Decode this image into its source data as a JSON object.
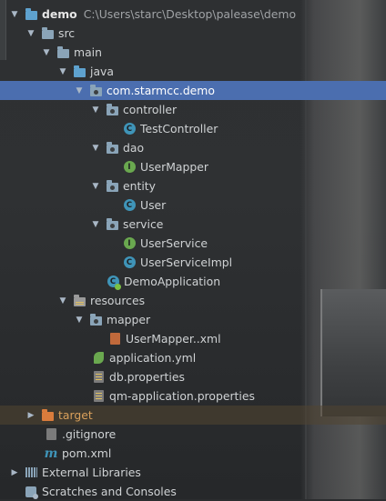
{
  "tree": [
    {
      "label": "demo",
      "path": "C:\\Users\\starc\\Desktop\\palease\\demo",
      "arrow": "▼",
      "icon": "module-folder-icon"
    },
    {
      "label": "src",
      "arrow": "▼",
      "icon": "folder-icon"
    },
    {
      "label": "main",
      "arrow": "▼",
      "icon": "folder-icon"
    },
    {
      "label": "java",
      "arrow": "▼",
      "icon": "source-folder-icon"
    },
    {
      "label": "com.starmcc.demo",
      "arrow": "▼",
      "icon": "package-icon"
    },
    {
      "label": "controller",
      "arrow": "▼",
      "icon": "package-icon"
    },
    {
      "label": "TestController",
      "icon": "class-icon",
      "badge": "C"
    },
    {
      "label": "dao",
      "arrow": "▼",
      "icon": "package-icon"
    },
    {
      "label": "UserMapper",
      "icon": "interface-icon",
      "badge": "I"
    },
    {
      "label": "entity",
      "arrow": "▼",
      "icon": "package-icon"
    },
    {
      "label": "User",
      "icon": "class-icon",
      "badge": "C"
    },
    {
      "label": "service",
      "arrow": "▼",
      "icon": "package-icon"
    },
    {
      "label": "UserService",
      "icon": "interface-icon",
      "badge": "I"
    },
    {
      "label": "UserServiceImpl",
      "icon": "class-icon",
      "badge": "C"
    },
    {
      "label": "DemoApplication",
      "icon": "spring-boot-app-icon",
      "badge": "C"
    },
    {
      "label": "resources",
      "arrow": "▼",
      "icon": "resources-folder-icon"
    },
    {
      "label": "mapper",
      "arrow": "▼",
      "icon": "package-icon"
    },
    {
      "label": "UserMapper..xml",
      "icon": "xml-file-icon"
    },
    {
      "label": "application.yml",
      "icon": "yml-file-icon"
    },
    {
      "label": "db.properties",
      "icon": "properties-file-icon"
    },
    {
      "label": "qm-application.properties",
      "icon": "properties-file-icon"
    },
    {
      "label": "target",
      "arrow": "▶",
      "icon": "excluded-folder-icon"
    },
    {
      "label": ".gitignore",
      "icon": "gitignore-file-icon"
    },
    {
      "label": "pom.xml",
      "icon": "maven-icon"
    },
    {
      "label": "External Libraries",
      "arrow": "▶",
      "icon": "libraries-icon"
    },
    {
      "label": "Scratches and Consoles",
      "icon": "scratches-icon"
    }
  ],
  "colors": {
    "selection": "#4b6eaf",
    "background": "#2b2d2f",
    "class_icon": "#3f94b8",
    "interface_icon": "#6aa84f",
    "excluded_folder": "#d97c3c"
  }
}
